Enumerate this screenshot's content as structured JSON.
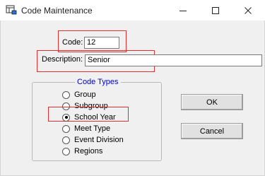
{
  "window": {
    "title": "Code Maintenance",
    "icon": "app-table-icon",
    "controls": [
      "minimize-icon",
      "maximize-icon",
      "close-icon"
    ]
  },
  "form": {
    "code_label": "Code:",
    "code_value": "12",
    "description_label": "Description:",
    "description_value": "Senior"
  },
  "code_types": {
    "title": "Code Types",
    "options": [
      {
        "label": "Group",
        "selected": false
      },
      {
        "label": "Subgroup",
        "selected": false
      },
      {
        "label": "School Year",
        "selected": true
      },
      {
        "label": "Meet Type",
        "selected": false
      },
      {
        "label": "Event Division",
        "selected": false
      },
      {
        "label": "Regions",
        "selected": false
      }
    ]
  },
  "buttons": {
    "ok": "OK",
    "cancel": "Cancel"
  },
  "colors": {
    "highlight": "#e03030",
    "group_title": "#0000cc"
  }
}
